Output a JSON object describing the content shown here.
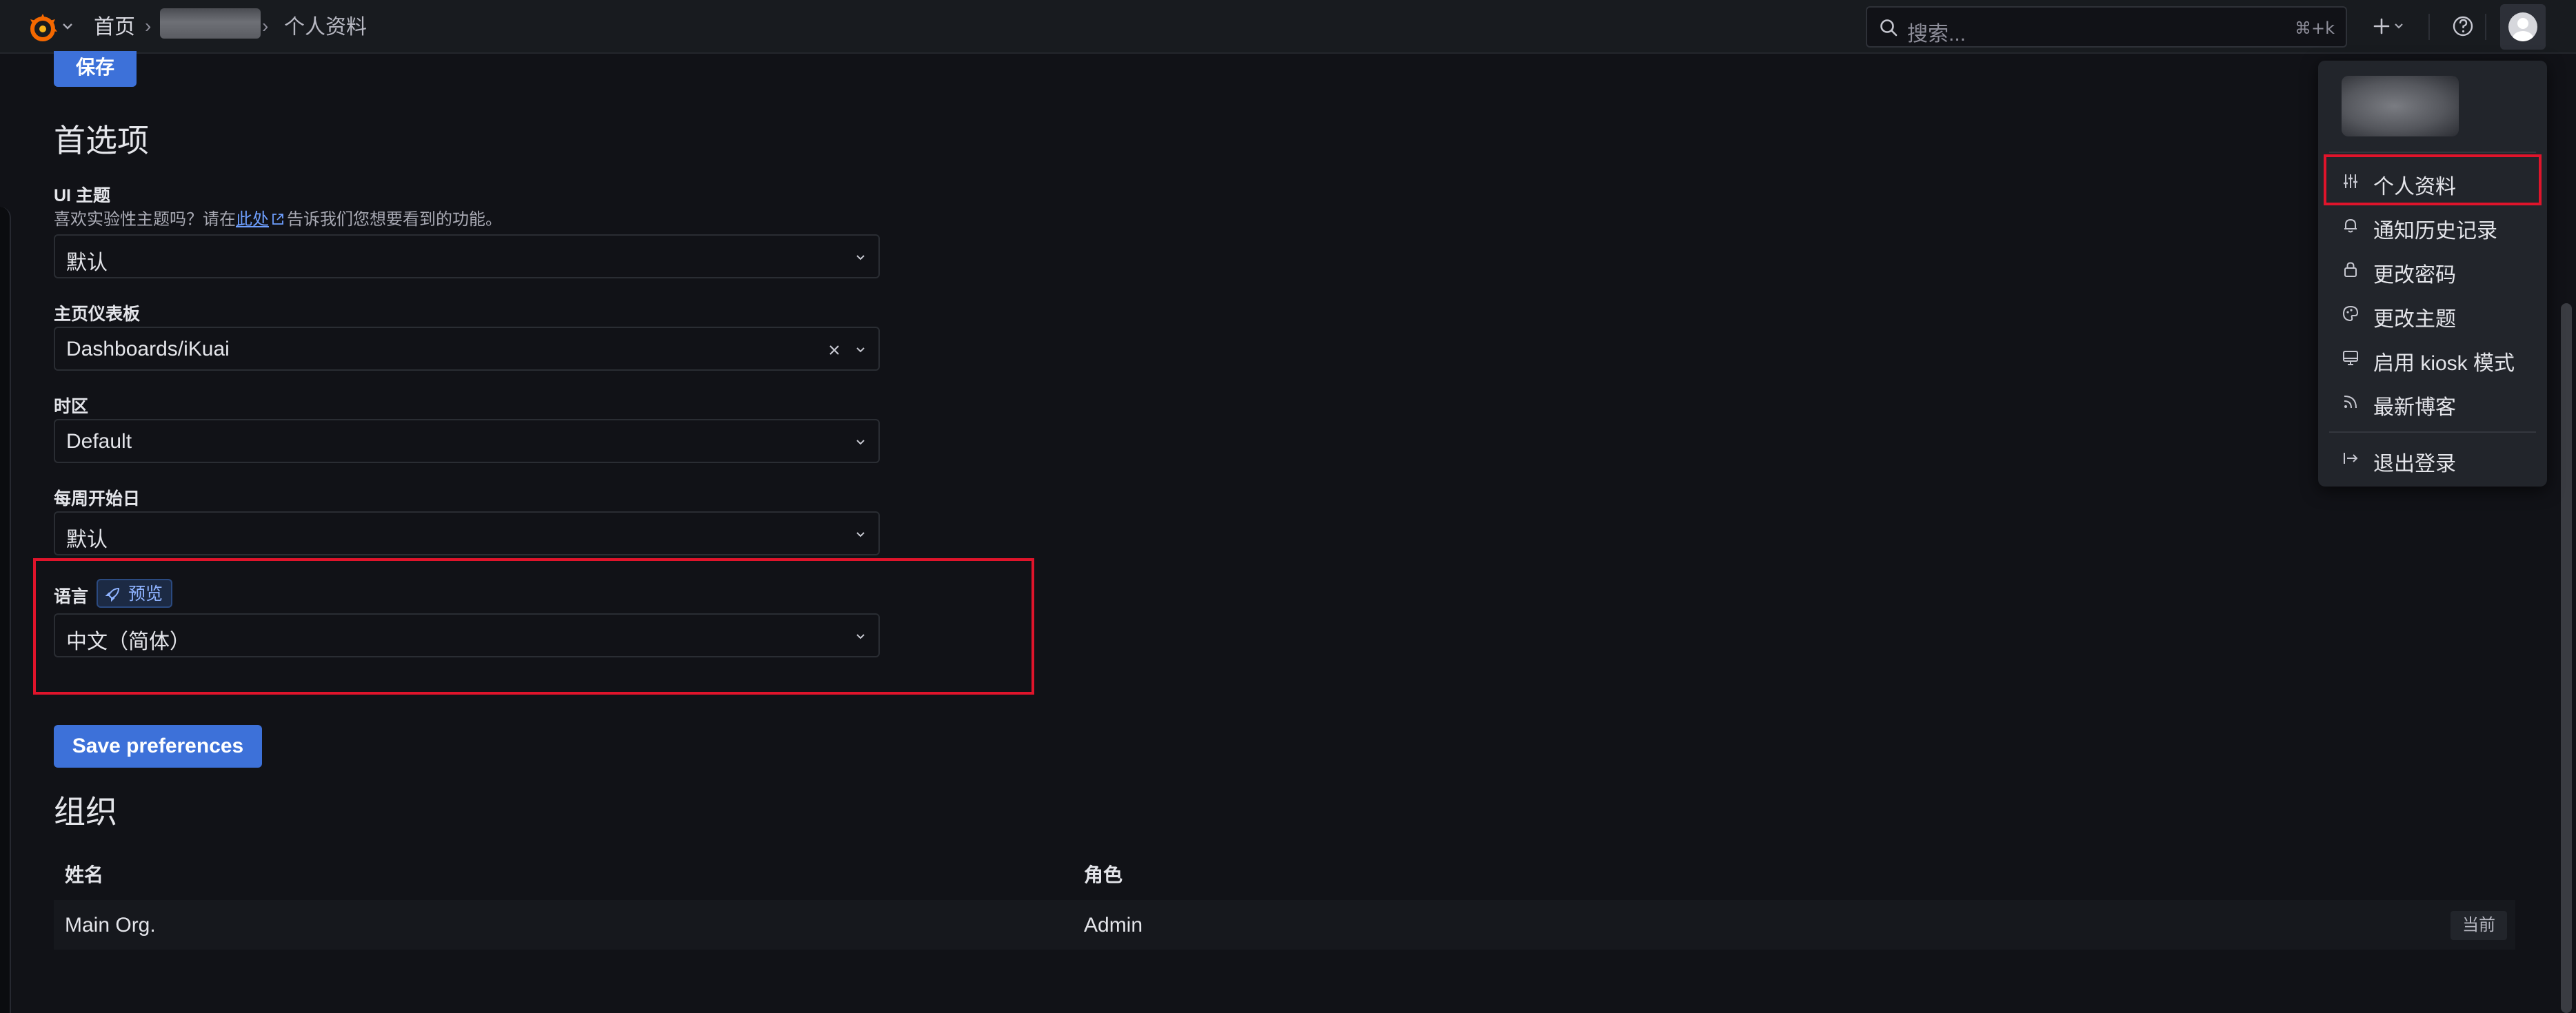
{
  "topbar": {
    "breadcrumb_home": "首页",
    "breadcrumb_current": "个人资料",
    "search_placeholder": "搜索...",
    "search_shortcut": "⌘+k"
  },
  "main": {
    "save_top_label": "保存",
    "preferences_title": "首选项",
    "ui_theme": {
      "label": "UI 主题",
      "desc_prefix": "喜欢实验性主题吗？请在",
      "desc_link": "此处",
      "desc_suffix": "告诉我们您想要看到的功能。",
      "value": "默认"
    },
    "home_dashboard": {
      "label": "主页仪表板",
      "value": "Dashboards/iKuai"
    },
    "timezone": {
      "label": "时区",
      "value": "Default"
    },
    "week_start": {
      "label": "每周开始日",
      "value": "默认"
    },
    "language": {
      "label": "语言",
      "badge": "预览",
      "value": "中文（简体）"
    },
    "save_preferences_label": "Save preferences",
    "org_title": "组织",
    "org_table": {
      "headers": [
        "姓名",
        "角色"
      ],
      "rows": [
        {
          "name": "Main Org.",
          "role": "Admin",
          "status": "当前"
        }
      ]
    }
  },
  "menu": {
    "items": [
      {
        "label": "个人资料",
        "icon": "sliders-icon"
      },
      {
        "label": "通知历史记录",
        "icon": "bell-icon"
      },
      {
        "label": "更改密码",
        "icon": "lock-icon"
      },
      {
        "label": "更改主题",
        "icon": "palette-icon"
      },
      {
        "label": "启用 kiosk 模式",
        "icon": "monitor-icon"
      },
      {
        "label": "最新博客",
        "icon": "rss-icon"
      }
    ],
    "signout_label": "退出登录"
  },
  "colors": {
    "accent": "#3d71d9",
    "highlight": "#e0142b",
    "brand": "#f46800",
    "background": "#111217"
  }
}
